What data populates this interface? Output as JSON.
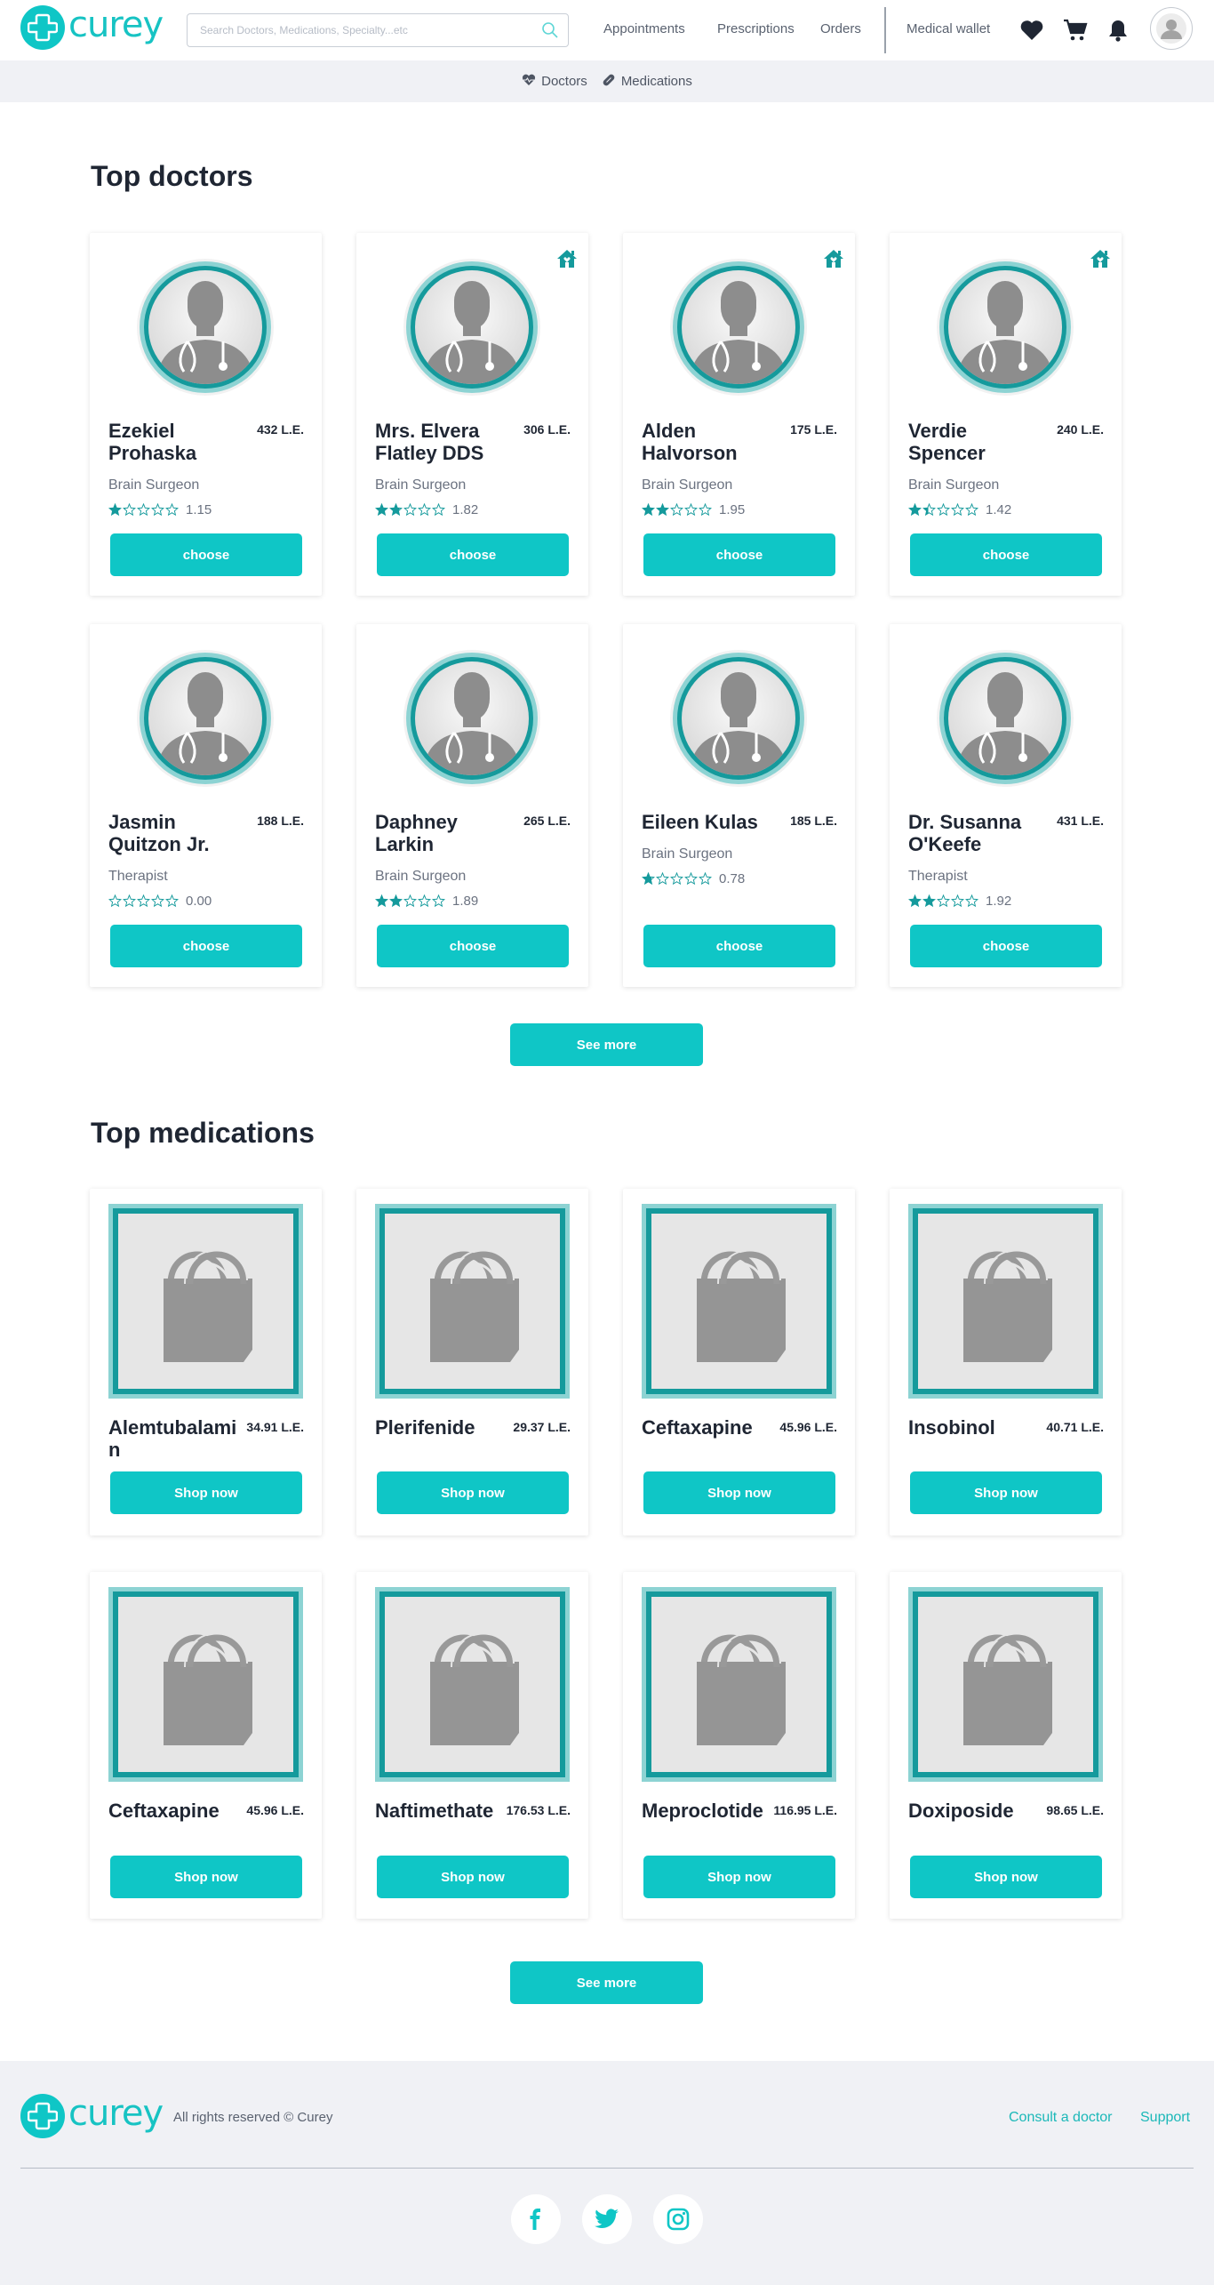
{
  "header": {
    "brand": "curey",
    "search_placeholder": "Search Doctors, Medications, Specialty...etc",
    "nav": [
      "Appointments",
      "Prescriptions",
      "Orders"
    ],
    "wallet": "Medical wallet"
  },
  "subnav": {
    "doctors": "Doctors",
    "medications": "Medications"
  },
  "doctors_section": {
    "title": "Top doctors",
    "button_label": "choose",
    "see_more": "See more",
    "items": [
      {
        "name": "Ezekiel Prohaska",
        "price": "432 L.E.",
        "specialty": "Brain Surgeon",
        "rating": "1.15",
        "home": false
      },
      {
        "name": "Mrs. Elvera Flatley DDS",
        "price": "306 L.E.",
        "specialty": "Brain Surgeon",
        "rating": "1.82",
        "home": true
      },
      {
        "name": "Alden Halvorson",
        "price": "175 L.E.",
        "specialty": "Brain Surgeon",
        "rating": "1.95",
        "home": true
      },
      {
        "name": "Verdie Spencer",
        "price": "240 L.E.",
        "specialty": "Brain Surgeon",
        "rating": "1.42",
        "home": true
      },
      {
        "name": "Jasmin Quitzon Jr.",
        "price": "188 L.E.",
        "specialty": "Therapist",
        "rating": "0.00",
        "home": false
      },
      {
        "name": "Daphney Larkin",
        "price": "265 L.E.",
        "specialty": "Brain Surgeon",
        "rating": "1.89",
        "home": false
      },
      {
        "name": "Eileen Kulas",
        "price": "185 L.E.",
        "specialty": "Brain Surgeon",
        "rating": "0.78",
        "home": false
      },
      {
        "name": "Dr. Susanna O'Keefe",
        "price": "431 L.E.",
        "specialty": "Therapist",
        "rating": "1.92",
        "home": false
      }
    ]
  },
  "medications_section": {
    "title": "Top medications",
    "button_label": "Shop now",
    "see_more": "See more",
    "items": [
      {
        "name": "Alemtubalamin",
        "price": "34.91 L.E."
      },
      {
        "name": "Plerifenide",
        "price": "29.37 L.E."
      },
      {
        "name": "Ceftaxapine",
        "price": "45.96 L.E."
      },
      {
        "name": "Insobinol",
        "price": "40.71 L.E."
      },
      {
        "name": "Ceftaxapine",
        "price": "45.96 L.E."
      },
      {
        "name": "Naftimethate",
        "price": "176.53 L.E."
      },
      {
        "name": "Meproclotide",
        "price": "116.95 L.E."
      },
      {
        "name": "Doxiposide",
        "price": "98.65 L.E."
      }
    ]
  },
  "footer": {
    "brand": "curey",
    "copyright": "All rights reserved © Curey",
    "links": [
      "Consult a doctor",
      "Support"
    ],
    "social": [
      "facebook-icon",
      "twitter-icon",
      "instagram-icon"
    ]
  },
  "colors": {
    "accent": "#0fc6c6",
    "teal_dark": "#159a9c",
    "text": "#1f2633"
  }
}
